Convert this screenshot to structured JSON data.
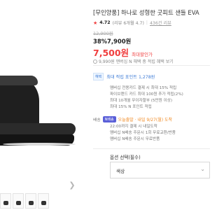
{
  "product": {
    "title": "[무인양품] 하나로 성형한 굿피트 샌들 EVA",
    "rating": "4.72",
    "rating_meta": "(리뷰 6개월 4.7)",
    "review_link": "436건 리뷰",
    "original_price": "12,900원",
    "discount_rate": "38%",
    "discount_price": "7,900원",
    "sale_price": "7,500원",
    "sale_label": "최대할인가",
    "points_text": "9,990원 맨버십 N 해택 중 적립 혜택 보기"
  },
  "benefits": {
    "tag": "혜택",
    "headline": "최대 적립 포인트 1,278원",
    "lines": [
      "멤버십 전용카드 결제 시 최대 15% 적립",
      "파이브랜드 카드 최대 100원 추가 적립(2%)",
      "최대 10개월 무이자할부 (5만원 이상)",
      "최대 15%  N 포인트 적립"
    ]
  },
  "shipping": {
    "label": "배송",
    "badge": "N배송",
    "headline": "오늘출발 · 내일 9/27(월) 도착",
    "lines": [
      "22:00까지 결제 시 내일도착",
      "멤버십 N배송 주문시 1회 무료교환/반품",
      "멤버십 N배송 주문시 무료반품"
    ]
  },
  "options": {
    "label": "옵션 선택(필수)",
    "select_value": "색상"
  },
  "icons": {
    "star": "star-icon",
    "chevron": "chevron-down-icon",
    "next": "chevron-right-icon"
  },
  "colors": {
    "accent": "#f03e3e",
    "link": "#3d7bd6",
    "ship": "#f08a24",
    "naver": "#03c75a"
  }
}
